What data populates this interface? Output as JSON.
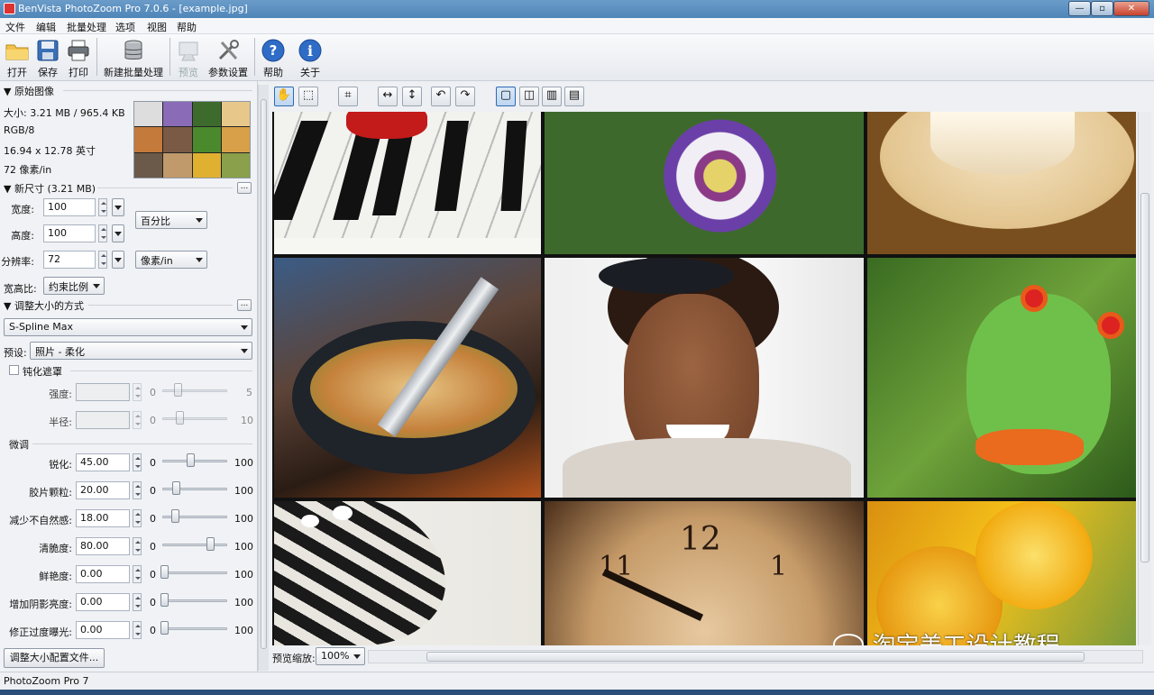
{
  "title": "BenVista PhotoZoom Pro 7.0.6 - [example.jpg]",
  "window_buttons": {
    "min": "—",
    "max": "▫",
    "close": "✕"
  },
  "menu": [
    "文件",
    "编辑",
    "批量处理",
    "选项",
    "视图",
    "帮助"
  ],
  "toolbar": {
    "open": "打开",
    "save": "保存",
    "print": "打印",
    "batch": "新建批量处理",
    "preview": "预览",
    "params": "参数设置",
    "help": "帮助",
    "about": "关于"
  },
  "original": {
    "title": "▼ 原始图像",
    "size": "大小: 3.21 MB / 965.4 KB",
    "color": "RGB/8",
    "dimensions": "16.94 x 12.78 英寸",
    "resolution": "72 像素/in"
  },
  "newsize": {
    "title": "▼ 新尺寸 (3.21 MB)",
    "width_label": "宽度:",
    "width_value": "100",
    "height_label": "高度:",
    "height_value": "100",
    "res_label": "分辨率:",
    "res_value": "72",
    "unit_select": "百分比",
    "res_unit_select": "像素/in",
    "aspect_label": "宽高比:",
    "aspect_select": "约束比例"
  },
  "resize_method": {
    "title": "▼ 调整大小的方式",
    "method": "S-Spline Max",
    "preset_label": "预设:",
    "preset": "照片 - 柔化"
  },
  "unsharp": {
    "title": "钝化遮罩",
    "strength_label": "强度:",
    "radius_label": "半径:",
    "strength_min": "0",
    "strength_max": "5",
    "radius_min": "0",
    "radius_max": "10"
  },
  "finetune": {
    "title": "微调",
    "rows": [
      {
        "label": "锐化:",
        "value": "45.00",
        "min": "0",
        "max": "100",
        "pos": 0.45
      },
      {
        "label": "胶片颗粒:",
        "value": "20.00",
        "min": "0",
        "max": "100",
        "pos": 0.2
      },
      {
        "label": "减少不自然感:",
        "value": "18.00",
        "min": "0",
        "max": "100",
        "pos": 0.18
      },
      {
        "label": "清脆度:",
        "value": "80.00",
        "min": "0",
        "max": "100",
        "pos": 0.8
      },
      {
        "label": "鲜艳度:",
        "value": "0.00",
        "min": "0",
        "max": "100",
        "pos": 0
      },
      {
        "label": "增加阴影亮度:",
        "value": "0.00",
        "min": "0",
        "max": "100",
        "pos": 0
      },
      {
        "label": "修正过度曝光:",
        "value": "0.00",
        "min": "0",
        "max": "100",
        "pos": 0
      }
    ]
  },
  "profile_button": "调整大小配置文件...",
  "zoom": {
    "label": "预览缩放:",
    "value": "100%"
  },
  "status": "PhotoZoom Pro 7",
  "watermark": "淘宝美工设计教程"
}
